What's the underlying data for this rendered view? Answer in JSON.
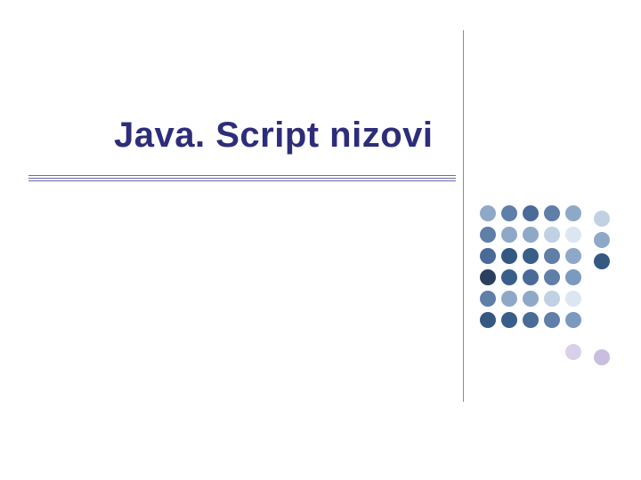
{
  "slide": {
    "title": "Java. Script nizovi"
  },
  "decor": {
    "dot_grid": {
      "rows": 7,
      "cols": 6,
      "colors": [
        [
          "#8ea8c8",
          "#5f7ea8",
          "#4a6a97",
          "#5f7ea8",
          "#8ea8c8",
          "#c0d1e3"
        ],
        [
          "#5f7ea8",
          "#8ea8c8",
          "#8ea8c8",
          "#c0d1e3",
          "#dbe6f1",
          "#8ea8c8"
        ],
        [
          "#4a6a97",
          "#345882",
          "#3a5e8a",
          "#5f7ea8",
          "#8ea8c8",
          "#345882"
        ],
        [
          "#2a3f5e",
          "#3a5e8a",
          "#4a6a97",
          "#5f7ea8",
          "#7a9abf",
          "none"
        ],
        [
          "#5f7ea8",
          "#8ea8c8",
          "#8ea8c8",
          "#c0d1e3",
          "#dbe6f1",
          "none"
        ],
        [
          "#345882",
          "#3a5e8a",
          "#4a6a97",
          "#5f7ea8",
          "#7a9abf",
          "none"
        ],
        [
          "none",
          "none",
          "none",
          "none",
          "#d8d0e8",
          "#c9bde0"
        ]
      ]
    }
  }
}
